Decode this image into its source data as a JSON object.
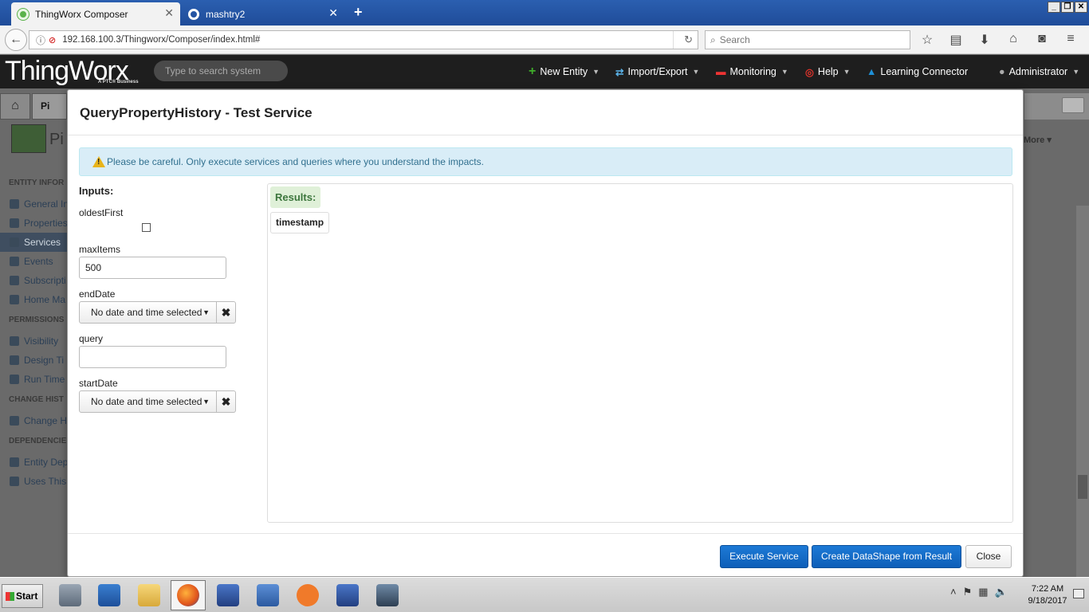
{
  "browser": {
    "tabs": [
      {
        "label": "ThingWorx Composer",
        "active": true
      },
      {
        "label": "mashtry2",
        "active": false
      }
    ],
    "new_tab_glyph": "+",
    "url": "192.168.100.3/Thingworx/Composer/index.html#",
    "search_placeholder": "Search",
    "icons": [
      "bookmark-star-icon",
      "reading-list-icon",
      "download-icon",
      "home-icon",
      "pocket-icon",
      "menu-icon"
    ]
  },
  "app": {
    "logo_text": "ThingWorx",
    "logo_sub": "A PTC® Business",
    "search_placeholder": "Type to search system",
    "menu": {
      "new_entity": "New Entity",
      "import_export": "Import/Export",
      "monitoring": "Monitoring",
      "help": "Help",
      "learning_connector": "Learning Connector",
      "user": "Administrator"
    },
    "colors": {
      "header_bg": "#1e1e1e",
      "new_entity_icon": "#3fae2a",
      "help_icon": "#d9332b",
      "learning_icon": "#1e8fd6"
    }
  },
  "background": {
    "entity_tab_label": "Pi",
    "entity_title": "Pi",
    "more_label": "More",
    "sections": [
      {
        "title": "ENTITY INFOR",
        "items": [
          "General In",
          "Properties",
          "Services",
          "Events",
          "Subscripti",
          "Home Ma"
        ]
      },
      {
        "title": "PERMISSIONS",
        "items": [
          "Visibility",
          "Design Ti",
          "Run Time"
        ]
      },
      {
        "title": "CHANGE HIST",
        "items": [
          "Change H"
        ]
      },
      {
        "title": "DEPENDENCIE",
        "items": [
          "Entity Dep",
          "Uses This"
        ]
      }
    ],
    "selected_item": "Services"
  },
  "modal": {
    "title": "QueryPropertyHistory - Test Service",
    "alert": "Please be careful. Only execute services and queries where you understand the impacts.",
    "inputs_heading": "Inputs:",
    "fields": {
      "oldestFirst": {
        "label": "oldestFirst",
        "checked": false
      },
      "maxItems": {
        "label": "maxItems",
        "value": "500"
      },
      "endDate": {
        "label": "endDate",
        "value": "No date and time selected"
      },
      "query": {
        "label": "query",
        "value": ""
      },
      "startDate": {
        "label": "startDate",
        "value": "No date and time selected"
      }
    },
    "results_heading": "Results:",
    "result_columns": [
      "timestamp"
    ],
    "buttons": {
      "execute": "Execute Service",
      "create_datashape": "Create DataShape from Result",
      "close": "Close"
    },
    "colors": {
      "primary": "#0d67c4",
      "alert_bg": "#d9edf7",
      "alert_text": "#31708f",
      "results_bg": "#dff0d8",
      "results_text": "#3c763d"
    }
  },
  "taskbar": {
    "start_label": "Start",
    "time": "7:22 AM",
    "date": "9/18/2017"
  }
}
